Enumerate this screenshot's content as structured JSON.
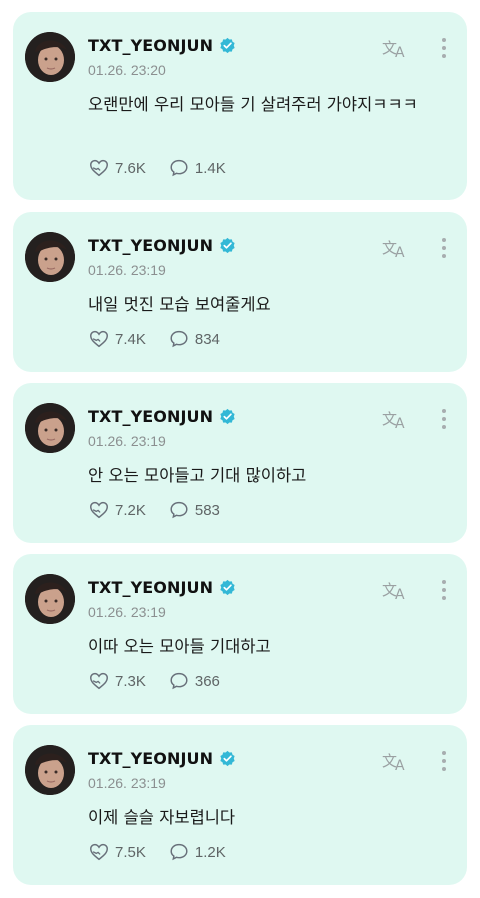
{
  "colors": {
    "card_background": "#dff8f1",
    "verified_badge": "#33b8d6",
    "muted_text": "#8b8f90"
  },
  "icons": {
    "verified": "verified-badge-icon",
    "translate": "translate-icon",
    "more": "more-vertical-icon",
    "like": "heart-hand-icon",
    "comment": "comment-bubble-icon"
  },
  "posts": [
    {
      "username": "TXT_YEONJUN",
      "timestamp": "01.26. 23:20",
      "text": "오랜만에 우리 모아들 기 살려주러 가야지ㅋㅋㅋ",
      "likes": "7.6K",
      "comments": "1.4K"
    },
    {
      "username": "TXT_YEONJUN",
      "timestamp": "01.26. 23:19",
      "text": "내일 멋진 모습 보여줄게요",
      "likes": "7.4K",
      "comments": "834"
    },
    {
      "username": "TXT_YEONJUN",
      "timestamp": "01.26. 23:19",
      "text": "안 오는 모아들고 기대 많이하고",
      "likes": "7.2K",
      "comments": "583"
    },
    {
      "username": "TXT_YEONJUN",
      "timestamp": "01.26. 23:19",
      "text": "이따 오는 모아들 기대하고",
      "likes": "7.3K",
      "comments": "366"
    },
    {
      "username": "TXT_YEONJUN",
      "timestamp": "01.26. 23:19",
      "text": "이제 슬슬 자보렵니다",
      "likes": "7.5K",
      "comments": "1.2K"
    }
  ]
}
